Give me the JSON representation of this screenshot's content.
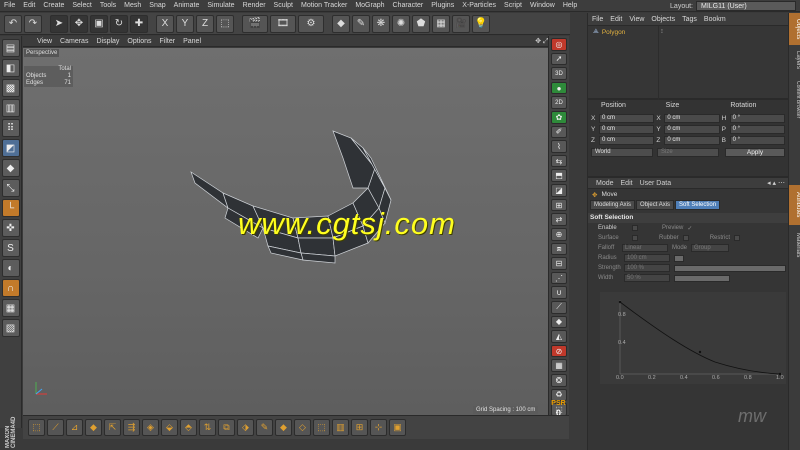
{
  "menubar": {
    "items": [
      "File",
      "Edit",
      "Create",
      "Select",
      "Tools",
      "Mesh",
      "Snap",
      "Animate",
      "Simulate",
      "Render",
      "Sculpt",
      "Motion Tracker",
      "MoGraph",
      "Character",
      "Plugins",
      "X-Particles",
      "Script",
      "Window",
      "Help"
    ],
    "layout_label": "Layout:",
    "layout_value": "MILG11 (User)"
  },
  "toolbar": {
    "axes": [
      "X",
      "Y",
      "Z"
    ]
  },
  "viewport": {
    "menu": [
      "View",
      "Cameras",
      "Display",
      "Options",
      "Filter",
      "Panel"
    ],
    "label": "Perspective",
    "stats": {
      "header": "Total",
      "rows": [
        {
          "k": "Objects",
          "v": "1"
        },
        {
          "k": "Edges",
          "v": "71"
        }
      ]
    },
    "grid_spacing": "Grid Spacing : 100 cm",
    "watermark": "www.cgtsj.com",
    "psr": "PSR",
    "psr_value": "0"
  },
  "vtools": {
    "labels": [
      "3D",
      "2D"
    ]
  },
  "maxon": "MAXON CINEMA4D",
  "objects": {
    "menu": [
      "File",
      "Edit",
      "View",
      "Objects",
      "Tags",
      "Bookm"
    ],
    "items": [
      {
        "name": "Polygon"
      }
    ]
  },
  "coords": {
    "headers": [
      "Position",
      "Size",
      "Rotation"
    ],
    "rows": [
      {
        "p_lab": "X",
        "p": "0 cm",
        "s_lab": "X",
        "s": "0 cm",
        "r_lab": "H",
        "r": "0 °"
      },
      {
        "p_lab": "Y",
        "p": "0 cm",
        "s_lab": "Y",
        "s": "0 cm",
        "r_lab": "P",
        "r": "0 °"
      },
      {
        "p_lab": "Z",
        "p": "0 cm",
        "s_lab": "Z",
        "s": "0 cm",
        "r_lab": "B",
        "r": "0 °"
      }
    ],
    "mode": "World",
    "size_mode": "Size",
    "apply": "Apply"
  },
  "attributes": {
    "menu": [
      "Mode",
      "Edit",
      "User Data"
    ],
    "title": "Move",
    "tabs": [
      "Modeling Axis",
      "Object Axis",
      "Soft Selection"
    ],
    "section": "Soft Selection",
    "enable": "Enable",
    "preview": "Preview",
    "surface": "Surface",
    "rubber": "Rubber",
    "restrict": "Restrict",
    "falloff_label": "Falloff",
    "falloff": "Linear",
    "mode_label": "Mode",
    "mode": "Group",
    "radius_label": "Radius",
    "radius": "100 cm",
    "strength_label": "Strength",
    "strength": "100 %",
    "width_label": "Width",
    "width": "50 %",
    "strength_fraction": 1.0,
    "width_fraction": 0.5
  },
  "sidetabs": [
    "Objects",
    "Layers",
    "Content Browser",
    "Attributes",
    "Materials"
  ],
  "falloff_graph": {
    "x_ticks": [
      "0.0",
      "0.2",
      "0.4",
      "0.6",
      "0.8",
      "1.0"
    ],
    "y_ticks": [
      "0.8",
      "0.4"
    ]
  },
  "colors": {
    "accent": "#4f7fb8",
    "watermark": "#ffff1f",
    "highlight": "#b07030"
  }
}
